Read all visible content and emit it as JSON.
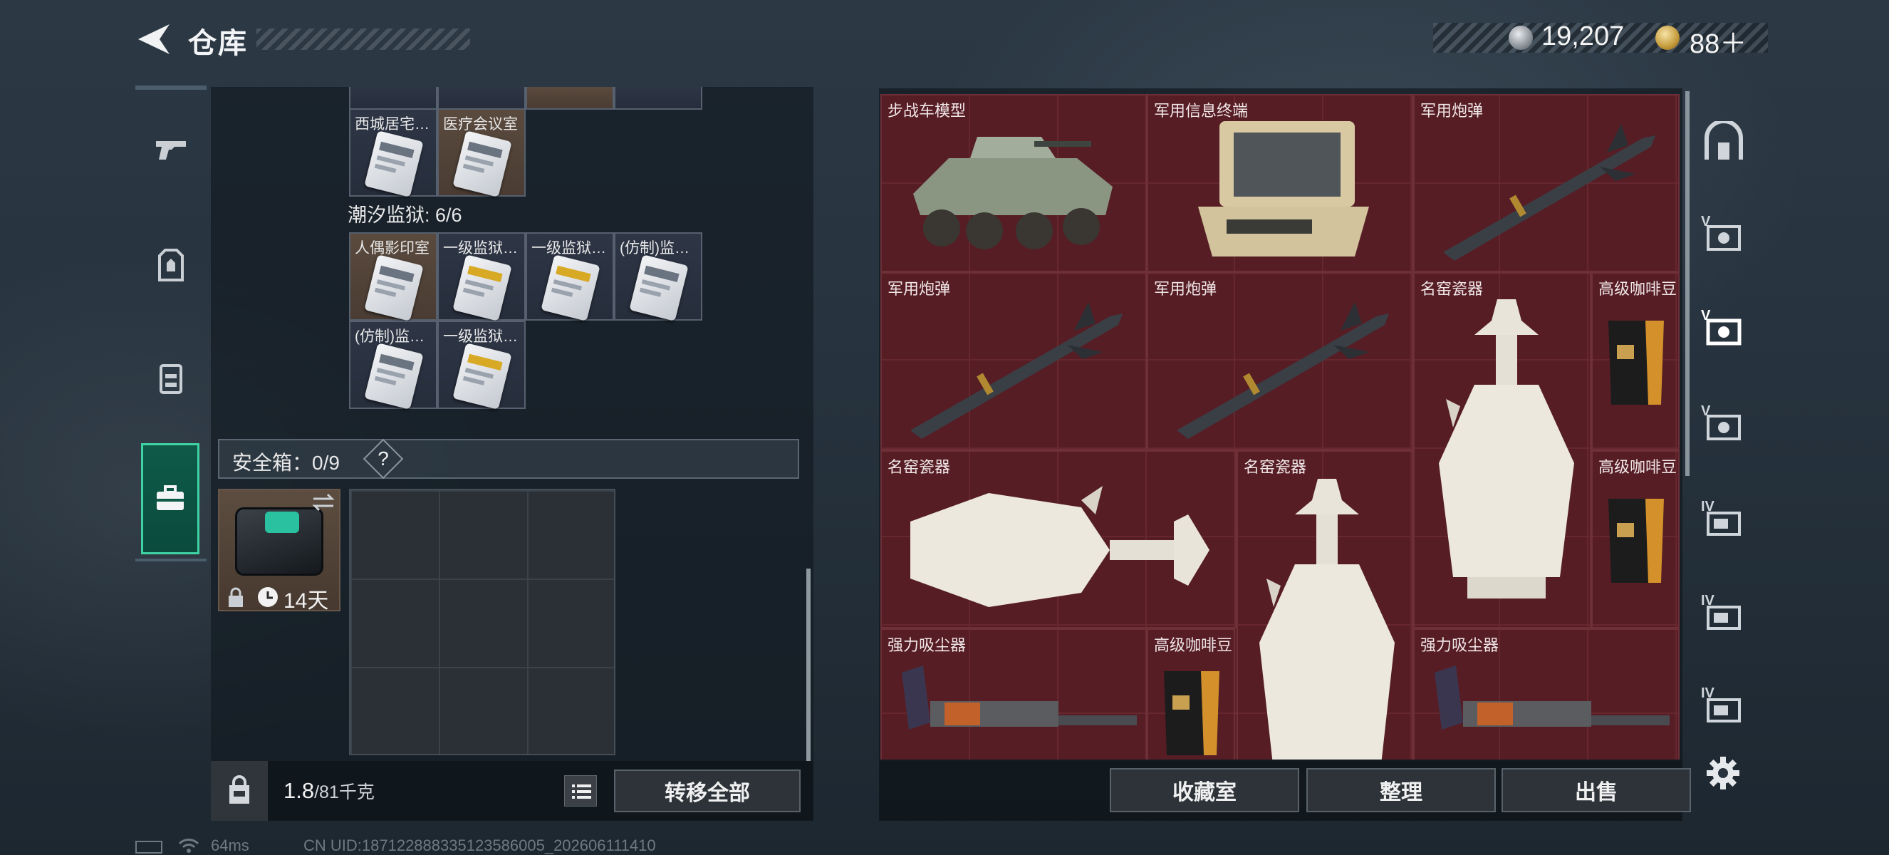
{
  "header": {
    "title": "仓库",
    "currency_silver": "19,207",
    "currency_gold": "88＋"
  },
  "left_panel": {
    "top_cells": [
      "西城居宅…",
      "医疗会议室"
    ],
    "section_title": "潮汐监狱: 6/6",
    "prison_cells": [
      "人偶影印室",
      "一级监狱…",
      "一级监狱…",
      "(仿制)监…",
      "(仿制)监…",
      "一级监狱…"
    ],
    "safebox_label": "安全箱：0/9",
    "safebox_help": "?",
    "case_days": "14天",
    "weight_value": "1.8",
    "weight_max": "/81千克",
    "transfer_all": "转移全部"
  },
  "stash": {
    "items": [
      {
        "label": "步战车模型"
      },
      {
        "label": "军用信息终端"
      },
      {
        "label": "军用炮弹"
      },
      {
        "label": "军用炮弹"
      },
      {
        "label": "军用炮弹"
      },
      {
        "label": "名窑瓷器"
      },
      {
        "label": "高级咖啡豆"
      },
      {
        "label": "名窑瓷器"
      },
      {
        "label": "名窑瓷器"
      },
      {
        "label": "高级咖啡豆"
      },
      {
        "label": "强力吸尘器"
      },
      {
        "label": "高级咖啡豆"
      },
      {
        "label": "强力吸尘器"
      }
    ]
  },
  "right_rail": {
    "tiers": [
      "V",
      "V",
      "V",
      "IV",
      "IV",
      "IV"
    ]
  },
  "actions": {
    "collection": "收藏室",
    "sort": "整理",
    "sell": "出售"
  },
  "status_bar": {
    "ping": "64ms",
    "uid": "CN UID:1871228883351235860​05_202606111410"
  },
  "colors": {
    "accent": "#3fd3a4",
    "stash_bg": "#5a2027"
  }
}
